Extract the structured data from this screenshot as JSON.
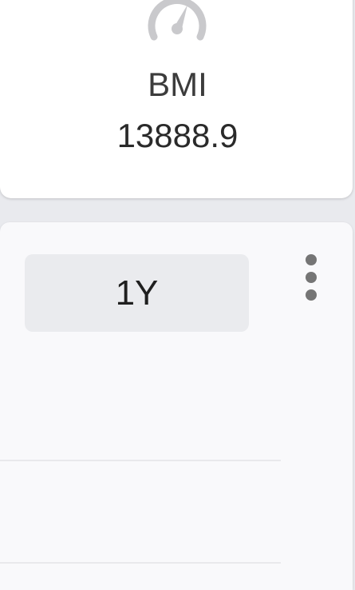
{
  "bmi_card": {
    "icon": "speedometer-icon",
    "label": "BMI",
    "value": "13888.9",
    "badge_color": "#e53935"
  },
  "chart_card": {
    "range_button": "1Y",
    "menu_icon": "more-vert-icon"
  }
}
